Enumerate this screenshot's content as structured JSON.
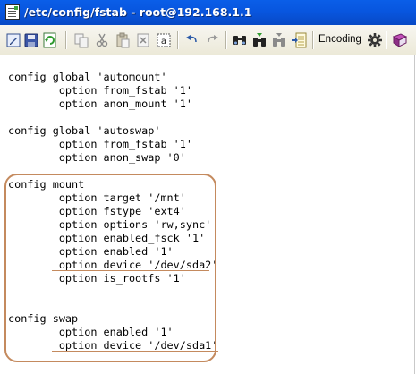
{
  "window": {
    "title": "/etc/config/fstab - root@192.168.1.1"
  },
  "toolbar": {
    "items": [
      {
        "icon": "edit-icon",
        "label": "Edit"
      },
      {
        "icon": "save-icon",
        "label": "Save"
      },
      {
        "icon": "refresh-icon",
        "label": "Refresh"
      },
      {
        "icon": "copy-icon",
        "label": "Copy"
      },
      {
        "icon": "cut-icon",
        "label": "Cut"
      },
      {
        "icon": "paste-icon",
        "label": "Paste"
      },
      {
        "icon": "delete-icon",
        "label": "Delete"
      },
      {
        "icon": "select-all-icon",
        "label": "Select all"
      },
      {
        "icon": "undo-icon",
        "label": "Undo"
      },
      {
        "icon": "redo-icon",
        "label": "Redo"
      },
      {
        "icon": "find-icon",
        "label": "Find"
      },
      {
        "icon": "find-next-icon",
        "label": "Find next"
      },
      {
        "icon": "replace-icon",
        "label": "Replace"
      },
      {
        "icon": "goto-line-icon",
        "label": "Go to line"
      },
      {
        "icon": "settings-icon",
        "label": "Settings"
      },
      {
        "icon": "help-icon",
        "label": "Help"
      }
    ],
    "encoding_label": "Encoding"
  },
  "editor": {
    "lines": [
      "",
      "config global 'automount'",
      "        option from_fstab '1'",
      "        option anon_mount '1'",
      "",
      "config global 'autoswap'",
      "        option from_fstab '1'",
      "        option anon_swap '0'",
      "",
      "config mount",
      "        option target '/mnt'",
      "        option fstype 'ext4'",
      "        option options 'rw,sync'",
      "        option enabled_fsck '1'",
      "        option enabled '1'",
      "        option device '/dev/sda2'",
      "        option is_rootfs '1'",
      "",
      "",
      "config swap",
      "        option enabled '1'",
      "        option device '/dev/sda1'"
    ]
  },
  "colors": {
    "titlebar": "#0856df",
    "highlight": "#c48a5e"
  }
}
